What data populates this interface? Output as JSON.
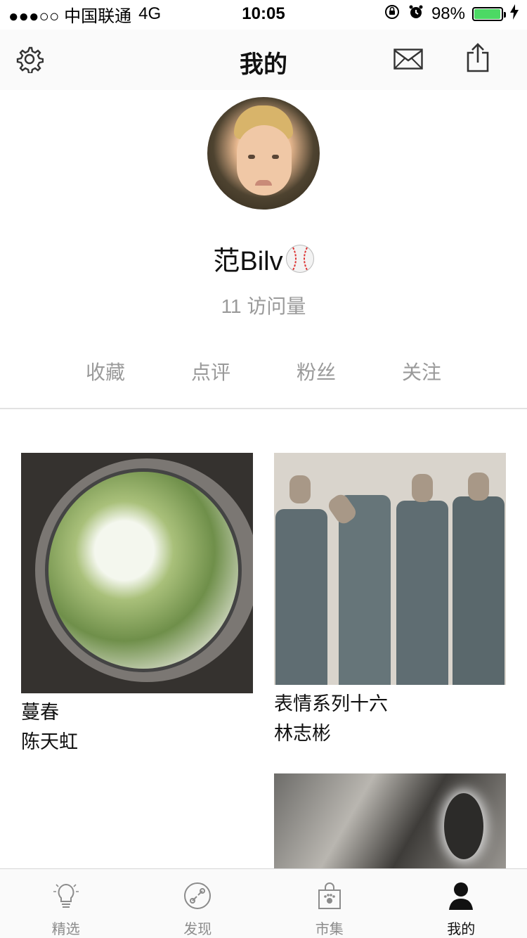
{
  "status_bar": {
    "carrier": "●●●○○ 中国联通",
    "network": "4G",
    "time": "10:05",
    "battery_percent": "98%",
    "battery_level": 0.98
  },
  "nav": {
    "title": "我的",
    "left_icon": "gear-icon",
    "right_icons": [
      "mail-icon",
      "share-icon"
    ]
  },
  "profile": {
    "username": "范Bilv",
    "username_emoji": "baseball-icon",
    "visits": "11 访问量"
  },
  "tabs": [
    {
      "label": "收藏"
    },
    {
      "label": "点评"
    },
    {
      "label": "粉丝"
    },
    {
      "label": "关注"
    }
  ],
  "cards": [
    {
      "title": "蔓春",
      "artist": "陈天虹"
    },
    {
      "title": "表情系列十六",
      "artist": "林志彬"
    },
    {
      "title": "",
      "artist": ""
    }
  ],
  "tab_bar": {
    "items": [
      {
        "label": "精选",
        "icon": "lightbulb-icon"
      },
      {
        "label": "发现",
        "icon": "compass-icon"
      },
      {
        "label": "市集",
        "icon": "shopping-bag-icon"
      },
      {
        "label": "我的",
        "icon": "person-icon"
      }
    ],
    "active_index": 3
  },
  "colors": {
    "text_primary": "#111111",
    "text_secondary": "#9a9a9a",
    "battery_green": "#4cd964",
    "divider": "#e2e2e2"
  }
}
